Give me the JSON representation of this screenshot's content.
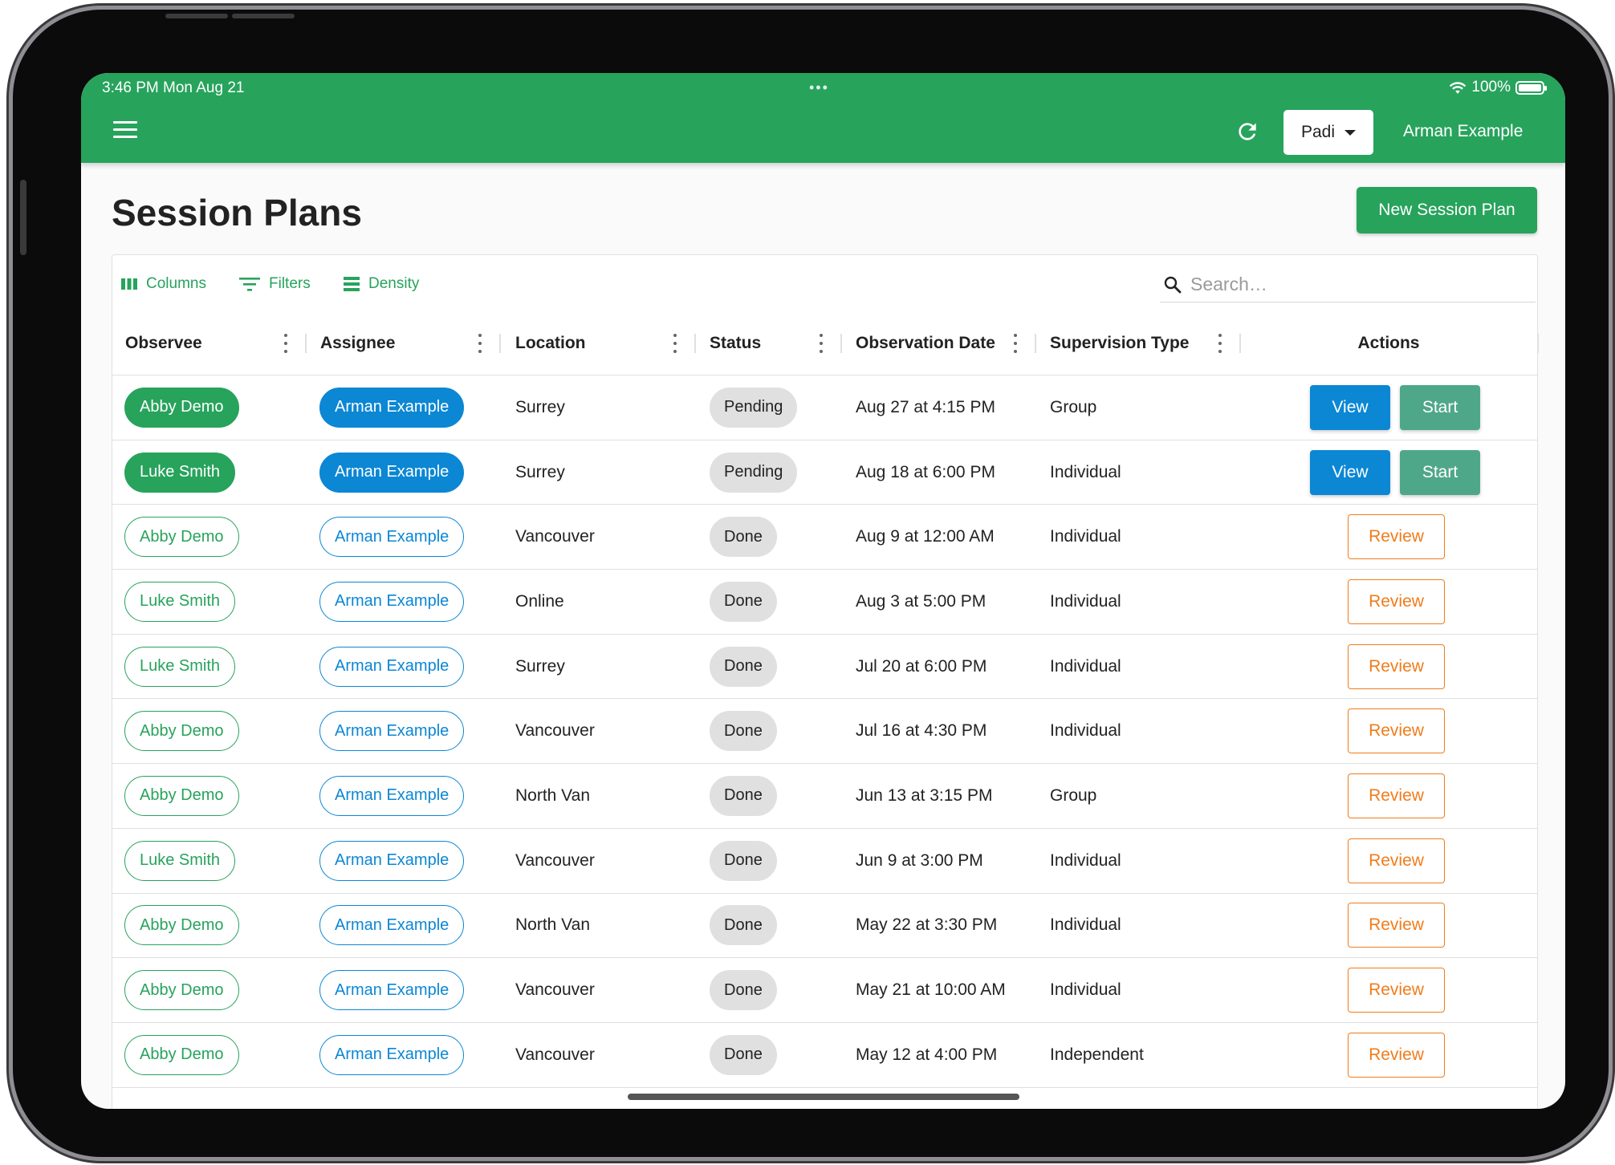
{
  "status_bar": {
    "time": "3:46 PM  Mon Aug 21",
    "dots": "•••",
    "battery": "100%"
  },
  "app_bar": {
    "org": "Padi",
    "user": "Arman Example"
  },
  "page": {
    "title": "Session Plans",
    "new_button": "New Session Plan"
  },
  "toolbar": {
    "columns": "Columns",
    "filters": "Filters",
    "density": "Density",
    "search_placeholder": "Search…"
  },
  "columns": [
    "Observee",
    "Assignee",
    "Location",
    "Status",
    "Observation Date",
    "Supervision Type",
    "Actions"
  ],
  "rows": [
    {
      "observee": "Abby Demo",
      "assignee": "Arman Example",
      "location": "Surrey",
      "status": "Pending",
      "date": "Aug 27 at 4:15 PM",
      "type": "Group",
      "actions": [
        "View",
        "Start"
      ]
    },
    {
      "observee": "Luke Smith",
      "assignee": "Arman Example",
      "location": "Surrey",
      "status": "Pending",
      "date": "Aug 18 at 6:00 PM",
      "type": "Individual",
      "actions": [
        "View",
        "Start"
      ]
    },
    {
      "observee": "Abby Demo",
      "assignee": "Arman Example",
      "location": "Vancouver",
      "status": "Done",
      "date": "Aug 9 at 12:00 AM",
      "type": "Individual",
      "actions": [
        "Review"
      ]
    },
    {
      "observee": "Luke Smith",
      "assignee": "Arman Example",
      "location": "Online",
      "status": "Done",
      "date": "Aug 3 at 5:00 PM",
      "type": "Individual",
      "actions": [
        "Review"
      ]
    },
    {
      "observee": "Luke Smith",
      "assignee": "Arman Example",
      "location": "Surrey",
      "status": "Done",
      "date": "Jul 20 at 6:00 PM",
      "type": "Individual",
      "actions": [
        "Review"
      ]
    },
    {
      "observee": "Abby Demo",
      "assignee": "Arman Example",
      "location": "Vancouver",
      "status": "Done",
      "date": "Jul 16 at 4:30 PM",
      "type": "Individual",
      "actions": [
        "Review"
      ]
    },
    {
      "observee": "Abby Demo",
      "assignee": "Arman Example",
      "location": "North Van",
      "status": "Done",
      "date": "Jun 13 at 3:15 PM",
      "type": "Group",
      "actions": [
        "Review"
      ]
    },
    {
      "observee": "Luke Smith",
      "assignee": "Arman Example",
      "location": "Vancouver",
      "status": "Done",
      "date": "Jun 9 at 3:00 PM",
      "type": "Individual",
      "actions": [
        "Review"
      ]
    },
    {
      "observee": "Abby Demo",
      "assignee": "Arman Example",
      "location": "North Van",
      "status": "Done",
      "date": "May 22 at 3:30 PM",
      "type": "Individual",
      "actions": [
        "Review"
      ]
    },
    {
      "observee": "Abby Demo",
      "assignee": "Arman Example",
      "location": "Vancouver",
      "status": "Done",
      "date": "May 21 at 10:00 AM",
      "type": "Individual",
      "actions": [
        "Review"
      ]
    },
    {
      "observee": "Abby Demo",
      "assignee": "Arman Example",
      "location": "Vancouver",
      "status": "Done",
      "date": "May 12 at 4:00 PM",
      "type": "Independent",
      "actions": [
        "Review"
      ]
    }
  ],
  "colors": {
    "brand_green": "#27a35c",
    "blue": "#0b87d4",
    "start_green": "#4fa78a",
    "review_orange": "#f07c1a"
  }
}
